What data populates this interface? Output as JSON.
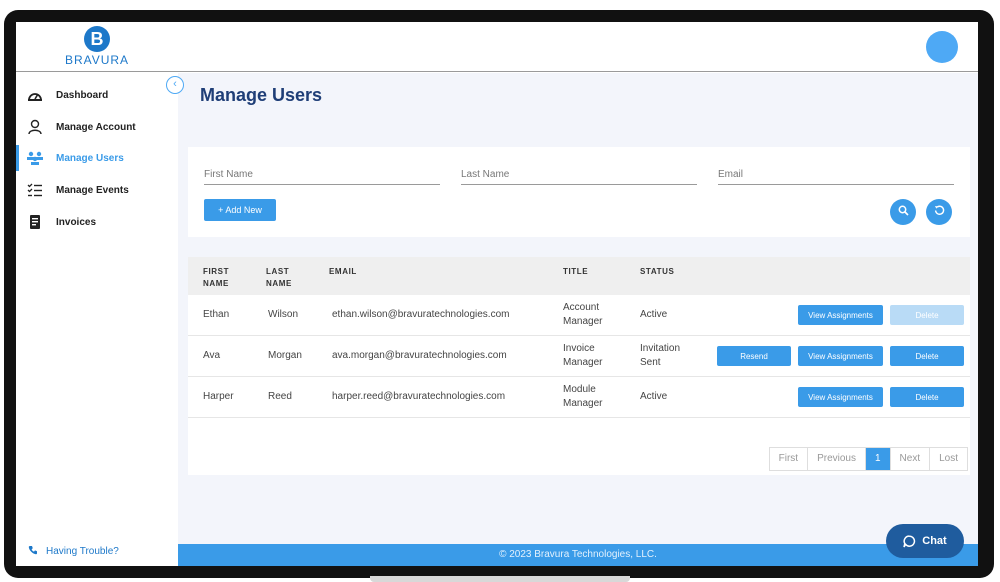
{
  "brand": {
    "logo_letter": "B",
    "name": "BRAVURA"
  },
  "sidebar": {
    "items": [
      {
        "label": "Dashboard",
        "icon": "dashboard-icon",
        "active": false
      },
      {
        "label": "Manage Account",
        "icon": "user-icon",
        "active": false
      },
      {
        "label": "Manage Users",
        "icon": "users-icon",
        "active": true
      },
      {
        "label": "Manage Events",
        "icon": "checklist-icon",
        "active": false
      },
      {
        "label": "Invoices",
        "icon": "invoice-icon",
        "active": false
      }
    ],
    "help_label": "Having Trouble?"
  },
  "main": {
    "title": "Manage Users",
    "filters": {
      "first_name_placeholder": "First Name",
      "last_name_placeholder": "Last Name",
      "email_placeholder": "Email",
      "add_label": "+ Add New"
    },
    "table": {
      "headers": {
        "first_name": "FIRST NAME",
        "last_name": "LAST NAME",
        "email": "EMAIL",
        "title": "TITLE",
        "status": "STATUS"
      },
      "rows": [
        {
          "first": "Ethan",
          "last": "Wilson",
          "email": "ethan.wilson@bravuratechnologies.com",
          "title": "Account Manager",
          "status": "Active",
          "actions": [
            "View Assignments",
            "Delete"
          ]
        },
        {
          "first": "Ava",
          "last": "Morgan",
          "email": "ava.morgan@bravuratechnologies.com",
          "title": "Invoice Manager",
          "status": "Invitation Sent",
          "actions": [
            "Resend",
            "View Assignments",
            "Delete"
          ]
        },
        {
          "first": "Harper",
          "last": "Reed",
          "email": "harper.reed@bravuratechnologies.com",
          "title": "Module Manager",
          "status": "Active",
          "actions": [
            "View Assignments",
            "Delete"
          ]
        }
      ]
    },
    "pagination": {
      "first": "First",
      "previous": "Previous",
      "current": "1",
      "next": "Next",
      "last": "Lost"
    }
  },
  "footer": {
    "text": "© 2023 Bravura Technologies, LLC."
  },
  "chat": {
    "label": "Chat"
  },
  "colors": {
    "accent": "#3a9be8",
    "title": "#1f3e77",
    "chat": "#1f5c9e"
  }
}
